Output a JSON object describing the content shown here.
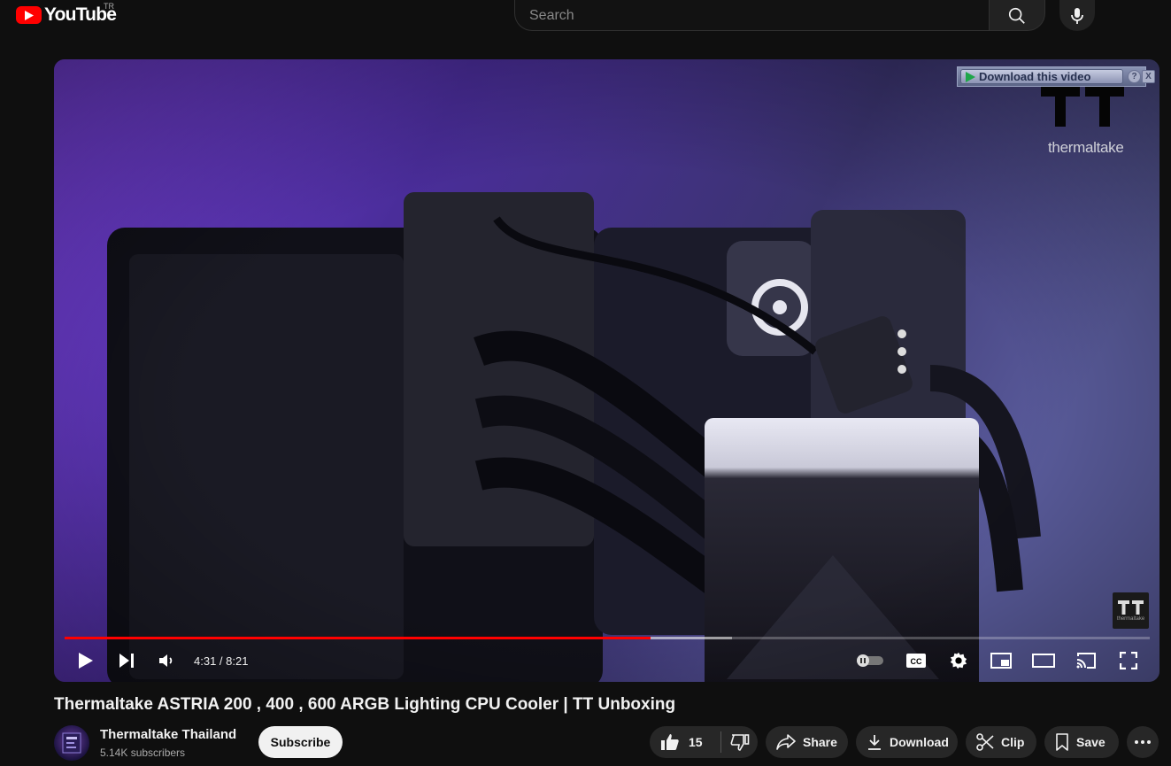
{
  "masthead": {
    "logo_text": "YouTube",
    "region": "TR",
    "search_placeholder": "Search"
  },
  "player": {
    "download_bar": {
      "label": "Download this video",
      "help": "?",
      "close": "X"
    },
    "brand_wordmark": "thermaltake",
    "watermark_text": "thermaltake",
    "current_time": "4:31",
    "duration": "8:21",
    "time_display": "4:31 / 8:21",
    "progress_played_fraction": 0.54,
    "progress_buffered_fraction": 0.615
  },
  "video": {
    "title": "Thermaltake ASTRIA 200 , 400 , 600 ARGB Lighting CPU Cooler | TT Unboxing"
  },
  "channel": {
    "name": "Thermaltake Thailand",
    "subscribers": "5.14K subscribers",
    "subscribe_label": "Subscribe"
  },
  "actions": {
    "like_count": "15",
    "share_label": "Share",
    "download_label": "Download",
    "clip_label": "Clip",
    "save_label": "Save"
  },
  "colors": {
    "background": "#0f0f0f",
    "brand_red": "#ff0000",
    "progress_red": "#ff0000",
    "pill_bg": "#272727"
  }
}
